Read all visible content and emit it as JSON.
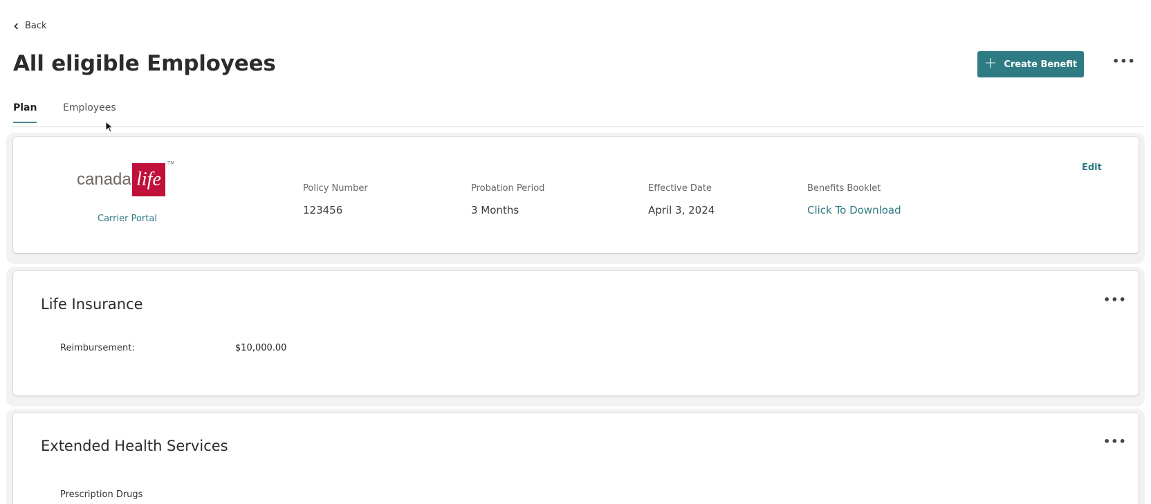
{
  "nav": {
    "back_label": "Back"
  },
  "header": {
    "title": "All eligible Employees",
    "create_button_label": "Create Benefit",
    "create_button_icon": "plus-icon",
    "more_icon": "more-horizontal-icon"
  },
  "tabs": [
    {
      "label": "Plan",
      "active": true
    },
    {
      "label": "Employees",
      "active": false
    }
  ],
  "carrier": {
    "logo_text": "canada",
    "logo_mark": "life",
    "logo_tm": "TM",
    "portal_link": "Carrier Portal",
    "edit_label": "Edit",
    "fields": [
      {
        "label": "Policy Number",
        "value": "123456"
      },
      {
        "label": "Probation Period",
        "value": "3 Months"
      },
      {
        "label": "Effective Date",
        "value": "April 3, 2024"
      },
      {
        "label": "Benefits Booklet",
        "value": "Click To Download"
      }
    ]
  },
  "sections": [
    {
      "title": "Life Insurance",
      "rows": [
        {
          "label": "Reimbursement:",
          "value": "$10,000.00"
        }
      ]
    },
    {
      "title": "Extended Health Services",
      "rows": [
        {
          "label": "Prescription Drugs"
        }
      ]
    }
  ],
  "colors": {
    "accent": "#2f7b84",
    "logo_red": "#c1103a"
  }
}
